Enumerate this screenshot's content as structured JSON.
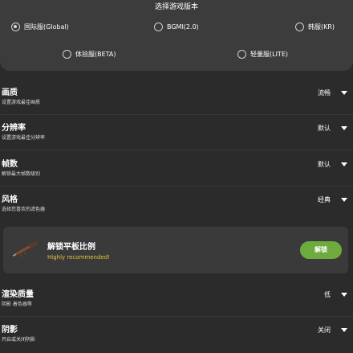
{
  "version_panel": {
    "title": "选择游戏版本",
    "options": [
      {
        "label": "国际服(Global)",
        "selected": true
      },
      {
        "label": "BGMI(2.0)",
        "selected": false
      },
      {
        "label": "韩服(KR)",
        "selected": false
      },
      {
        "label": "体验服(BETA)",
        "selected": false
      },
      {
        "label": "轻量服(LITE)",
        "selected": false
      }
    ]
  },
  "settings": {
    "quality": {
      "label": "画质",
      "desc": "设置游戏最佳画质",
      "value": "流畅"
    },
    "resolution": {
      "label": "分辨率",
      "desc": "设置游戏最佳分辨率",
      "value": "默认"
    },
    "fps": {
      "label": "帧数",
      "desc": "解锁最大帧数级别",
      "value": "默认"
    },
    "style": {
      "label": "风格",
      "desc": "选择您喜欢的滤色器",
      "value": "经典"
    },
    "render": {
      "label": "渲染质量",
      "desc": "阴影 着色器等",
      "value": "低"
    },
    "shadow": {
      "label": "阴影",
      "desc": "开启或关闭阴影",
      "value": "关闭"
    }
  },
  "ratio_card": {
    "title": "解锁平板比例",
    "subtitle": "Highly recommended!",
    "button_label": "解锁",
    "icon": "rifle-icon"
  },
  "colors": {
    "background": "#2b2b2b",
    "panel": "#3c3c3c",
    "accent_green": "#6dab3f",
    "accent_yellow": "#e6c23a"
  }
}
